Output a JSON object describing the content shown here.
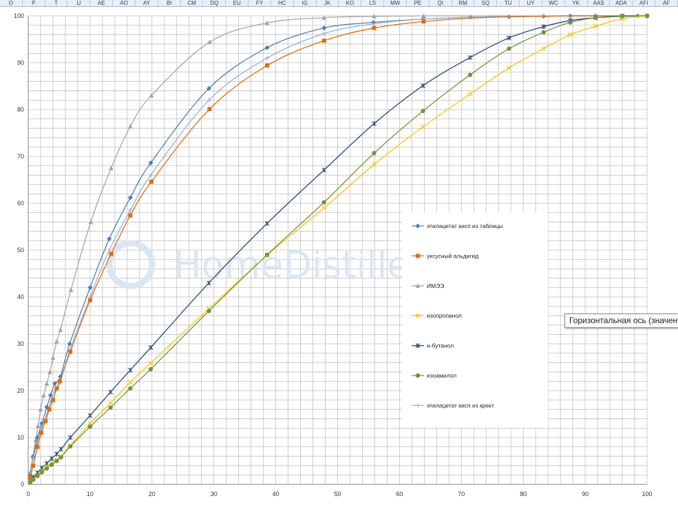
{
  "sheet": {
    "column_headers": [
      "O",
      "P",
      "T",
      "U",
      "AE",
      "AO",
      "AY",
      "BI",
      "CM",
      "DQ",
      "EU",
      "FY",
      "HC",
      "IG",
      "JK",
      "KO",
      "LS",
      "MW",
      "PE",
      "QI",
      "RM",
      "SQ",
      "TU",
      "UY",
      "WC",
      "YK",
      "AAS",
      "ADA",
      "AFI",
      "AF"
    ]
  },
  "watermark": "HomeDistiller.ru",
  "tooltip": "Горизонтальная ось (значения",
  "chart_data": {
    "type": "line",
    "title": "",
    "xlabel": "",
    "ylabel": "",
    "xlim": [
      0,
      100
    ],
    "ylim": [
      0,
      100
    ],
    "x_ticks": [
      0,
      10,
      20,
      30,
      40,
      50,
      60,
      70,
      80,
      90,
      100
    ],
    "y_ticks": [
      0,
      10,
      20,
      30,
      40,
      50,
      60,
      70,
      80,
      90,
      100
    ],
    "grid": true,
    "legend_position": "right",
    "series": [
      {
        "name": "этилацетат кисп из таблицы",
        "color": "#4a7ebb",
        "marker": "diamond",
        "x": [
          0.3,
          0.8,
          1.5,
          2.2,
          3.0,
          3.6,
          4.3,
          5.2,
          6.7,
          10.0,
          13.1,
          16.5,
          19.8,
          29.2,
          38.6,
          47.8,
          55.8,
          63.8,
          71.5,
          77.7,
          83.3,
          87.6,
          91.7,
          96.0,
          98.5,
          100.0
        ],
        "y": [
          2.0,
          6.0,
          10.0,
          13.0,
          16.5,
          19.0,
          21.5,
          23.0,
          30.0,
          42.0,
          52.4,
          61.2,
          68.6,
          84.5,
          93.2,
          97.4,
          98.6,
          99.3,
          99.7,
          99.8,
          99.9,
          100.0,
          100.0,
          100.0,
          100.0,
          100.0
        ]
      },
      {
        "name": "уксусный альдегид",
        "color": "#e36c0a",
        "marker": "square",
        "x": [
          0.3,
          0.8,
          1.5,
          2.1,
          2.8,
          3.4,
          4.0,
          4.6,
          5.1,
          6.8,
          10.0,
          13.4,
          16.5,
          19.9,
          29.3,
          38.6,
          47.8,
          55.9,
          63.9,
          71.5,
          77.7,
          83.3,
          87.6,
          91.7,
          96.0,
          100.0
        ],
        "y": [
          1.5,
          4.0,
          8.0,
          11.0,
          13.5,
          16.0,
          18.0,
          20.5,
          22.0,
          28.3,
          39.3,
          49.2,
          57.4,
          64.6,
          80.1,
          89.4,
          94.7,
          97.4,
          98.8,
          99.5,
          99.8,
          99.9,
          100.0,
          100.0,
          100.0,
          100.0
        ],
        "marker_x": [
          0.3,
          0.8,
          1.5,
          2.1,
          2.8,
          3.4,
          4.0,
          4.6,
          5.1,
          6.8,
          10.0,
          13.4,
          16.5,
          19.9,
          29.3,
          38.6,
          47.8,
          55.9,
          63.9
        ]
      },
      {
        "name": "ИМЭЭ",
        "color": "#a6a6a6",
        "marker": "triangle",
        "x": [
          0.3,
          0.8,
          1.2,
          1.6,
          2.0,
          2.5,
          3.0,
          3.5,
          4.0,
          4.6,
          5.2,
          6.9,
          10.1,
          13.4,
          16.5,
          19.9,
          29.3,
          38.6,
          47.8,
          55.9,
          63.9,
          71.5,
          77.7,
          83.3,
          87.6,
          91.7,
          96.0,
          100.0
        ],
        "y": [
          2.5,
          6.0,
          9.5,
          12.5,
          16.0,
          19.0,
          21.5,
          24.0,
          27.0,
          30.5,
          33.0,
          41.5,
          56.0,
          67.5,
          76.4,
          83.0,
          94.4,
          98.5,
          99.6,
          99.9,
          100.0,
          100.0,
          100.0,
          100.0,
          100.0,
          100.0,
          100.0,
          100.0
        ],
        "marker_x": [
          0.3,
          0.8,
          1.2,
          1.6,
          2.0,
          2.5,
          3.0,
          3.5,
          4.0,
          4.6,
          5.2,
          6.9,
          10.1,
          13.4,
          16.5,
          19.9,
          29.3,
          38.6,
          47.8,
          55.9,
          63.9
        ]
      },
      {
        "name": "изопропанол",
        "color": "#ffc000",
        "marker": "x",
        "x": [
          0.3,
          0.8,
          1.5,
          2.2,
          3.0,
          3.8,
          4.6,
          5.3,
          6.8,
          10.0,
          13.3,
          16.5,
          19.8,
          29.2,
          38.6,
          47.8,
          55.9,
          63.8,
          71.4,
          77.7,
          83.3,
          87.6,
          91.7,
          96.0,
          100.0
        ],
        "y": [
          0.5,
          1.2,
          2.0,
          3.0,
          3.8,
          4.5,
          5.2,
          6.0,
          8.3,
          13.0,
          17.4,
          21.8,
          25.9,
          37.5,
          48.9,
          59.0,
          68.3,
          76.3,
          83.3,
          88.9,
          93.0,
          96.0,
          97.8,
          99.4,
          100.0
        ]
      },
      {
        "name": "н-бутанол",
        "color": "#1f497d",
        "marker": "star",
        "x": [
          0.3,
          0.8,
          1.5,
          2.2,
          3.0,
          3.8,
          4.6,
          5.3,
          6.8,
          10.0,
          13.3,
          16.5,
          19.8,
          29.2,
          38.6,
          47.8,
          55.9,
          63.8,
          71.4,
          77.7,
          83.3,
          87.6,
          91.7,
          96.0,
          100.0
        ],
        "y": [
          0.6,
          1.5,
          2.5,
          3.5,
          4.5,
          5.5,
          6.5,
          7.5,
          10.0,
          14.7,
          19.7,
          24.4,
          29.2,
          43.0,
          55.7,
          67.1,
          77.0,
          85.1,
          91.1,
          95.3,
          97.7,
          99.0,
          99.6,
          99.9,
          100.0
        ]
      },
      {
        "name": "изоамилол",
        "color": "#77933c",
        "marker": "circle",
        "x": [
          0.3,
          0.8,
          1.5,
          2.2,
          3.0,
          3.8,
          4.6,
          5.3,
          6.8,
          10.0,
          13.3,
          16.5,
          19.8,
          29.2,
          38.6,
          47.8,
          55.9,
          63.8,
          71.4,
          77.7,
          83.3,
          87.6,
          91.7,
          96.0,
          100.0
        ],
        "y": [
          0.5,
          1.0,
          1.8,
          2.6,
          3.4,
          4.2,
          5.0,
          5.8,
          8.1,
          12.3,
          16.4,
          20.5,
          24.6,
          37.0,
          49.0,
          60.2,
          70.7,
          79.7,
          87.4,
          93.0,
          96.5,
          98.6,
          99.6,
          100.0,
          100.0
        ]
      },
      {
        "name": "этилацетат кисп из крект",
        "color": "#95b3d7",
        "marker": "plus",
        "x": [
          0.3,
          0.8,
          1.5,
          2.2,
          3.0,
          3.6,
          4.3,
          5.2,
          6.7,
          10.0,
          13.1,
          16.5,
          19.8,
          29.2,
          38.6,
          47.8,
          55.8,
          63.8,
          71.5,
          77.7,
          83.3,
          87.6,
          91.7,
          96.0,
          98.5,
          100.0
        ],
        "y": [
          1.8,
          5.5,
          9.0,
          12.0,
          15.0,
          17.5,
          20.0,
          22.0,
          28.5,
          40.0,
          50.0,
          58.5,
          66.0,
          82.0,
          91.0,
          96.2,
          98.3,
          99.3,
          99.7,
          99.9,
          100.0,
          100.0,
          100.0,
          100.0,
          100.0,
          100.0
        ]
      }
    ]
  }
}
